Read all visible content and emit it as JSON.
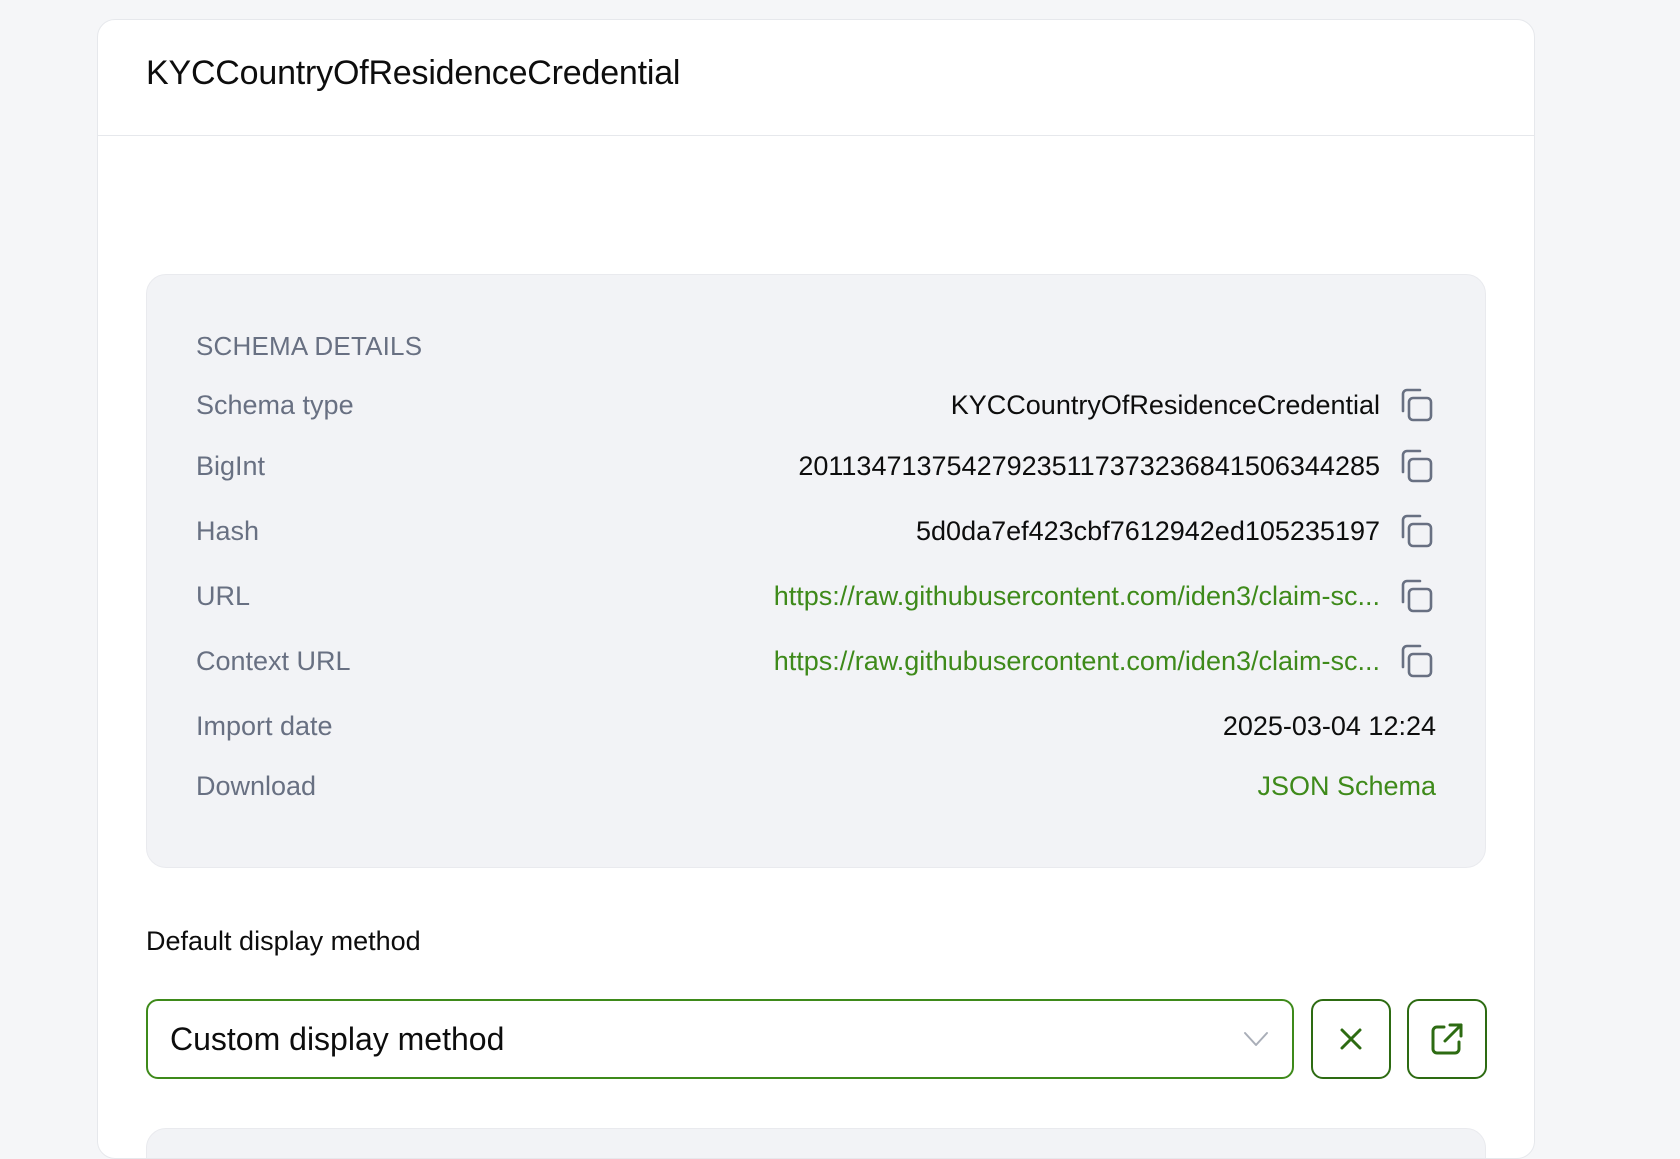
{
  "card": {
    "title": "KYCCountryOfResidenceCredential"
  },
  "schema_details": {
    "heading": "SCHEMA DETAILS",
    "rows": [
      {
        "label": "Schema type",
        "value": "KYCCountryOfResidenceCredential",
        "kind": "text",
        "copyable": true
      },
      {
        "label": "BigInt",
        "value": "201134713754279235117373236841506344285",
        "kind": "text",
        "copyable": true
      },
      {
        "label": "Hash",
        "value": "5d0da7ef423cbf7612942ed105235197",
        "kind": "text",
        "copyable": true
      },
      {
        "label": "URL",
        "value": "https://raw.githubusercontent.com/iden3/claim-sc...",
        "kind": "link",
        "copyable": true
      },
      {
        "label": "Context URL",
        "value": "https://raw.githubusercontent.com/iden3/claim-sc...",
        "kind": "link",
        "copyable": true
      },
      {
        "label": "Import date",
        "value": "2025-03-04 12:24",
        "kind": "text",
        "copyable": false
      },
      {
        "label": "Download",
        "value": "JSON Schema",
        "kind": "link",
        "copyable": false
      }
    ]
  },
  "display_method": {
    "label": "Default display method",
    "selected": "Custom display method"
  },
  "icons": {
    "copy": "copy-icon",
    "chevron": "chevron-down-icon",
    "clear": "close-icon",
    "open": "external-link-icon"
  },
  "colors": {
    "accent": "#3e8a1a",
    "accent_dark": "#2d6b12",
    "muted_text": "#687082",
    "panel_bg": "#f2f3f6"
  }
}
